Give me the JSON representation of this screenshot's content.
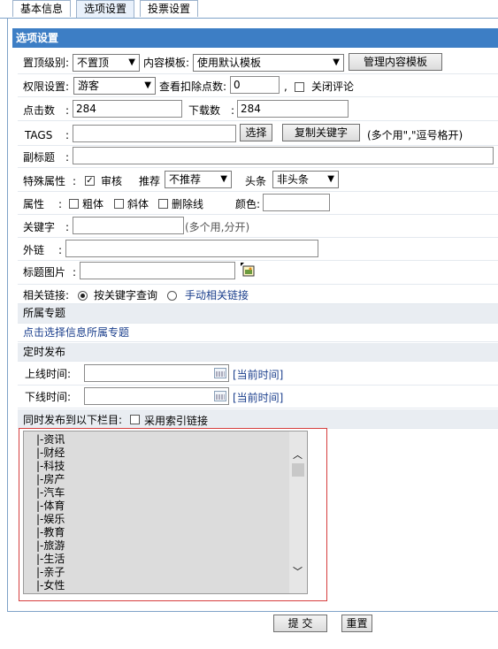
{
  "tabs": [
    "基本信息",
    "选项设置",
    "投票设置"
  ],
  "section_title": "选项设置",
  "top_level": {
    "label": "置顶级别:",
    "value": "不置顶"
  },
  "content_template": {
    "label": "内容模板:",
    "value": "使用默认模板",
    "manage_button": "管理内容模板"
  },
  "permission": {
    "label": "权限设置:",
    "value": "游客"
  },
  "deduct": {
    "label": "查看扣除点数:",
    "value": "0",
    "separator": ",",
    "close_comment_label": "关闭评论"
  },
  "clicks": {
    "label": "点击数",
    "colon": ":",
    "value": "284"
  },
  "downloads": {
    "label": "下载数",
    "colon": ":",
    "value": "284"
  },
  "tags": {
    "label": "TAGS",
    "colon": ":",
    "value": "",
    "choose_button": "选择",
    "copy_button": "复制关键字",
    "hint": "(多个用\",\"逗号格开)"
  },
  "subtitle": {
    "label": "副标题",
    "colon": ":",
    "value": ""
  },
  "special": {
    "label": "特殊属性",
    "colon": ":",
    "review_label": "审核",
    "recommend_label": "推荐",
    "recommend_value": "不推荐",
    "headline_label": "头条",
    "headline_value": "非头条"
  },
  "attributes": {
    "label": "属性",
    "colon": ":",
    "bold_label": "粗体",
    "italic_label": "斜体",
    "strike_label": "删除线",
    "color_label": "颜色:",
    "color_value": ""
  },
  "keywords": {
    "label": "关键字",
    "colon": ":",
    "value": "",
    "hint": "(多个用,分开)"
  },
  "external_link": {
    "label": "外链",
    "colon": ":",
    "value": ""
  },
  "title_image": {
    "label": "标题图片",
    "colon": ":",
    "value": ""
  },
  "related_links": {
    "label": "相关链接:",
    "option1": "按关键字查询",
    "option2": "手动相关链接"
  },
  "topic": {
    "title": "所属专题",
    "link": "点击选择信息所属专题"
  },
  "schedule": {
    "title": "定时发布",
    "online_label": "上线时间:",
    "offline_label": "下线时间:",
    "current_time_link": "[当前时间]"
  },
  "publish_to": {
    "label": "同时发布到以下栏目:",
    "index_link_label": "采用索引链接"
  },
  "columns": [
    "|-资讯",
    "|-财经",
    "|-科技",
    "|-房产",
    "|-汽车",
    "|-体育",
    "|-娱乐",
    "|-教育",
    "|-旅游",
    "|-生活",
    "|-亲子",
    "|-女性"
  ],
  "submit_button": "提 交",
  "reset_button": "重置"
}
